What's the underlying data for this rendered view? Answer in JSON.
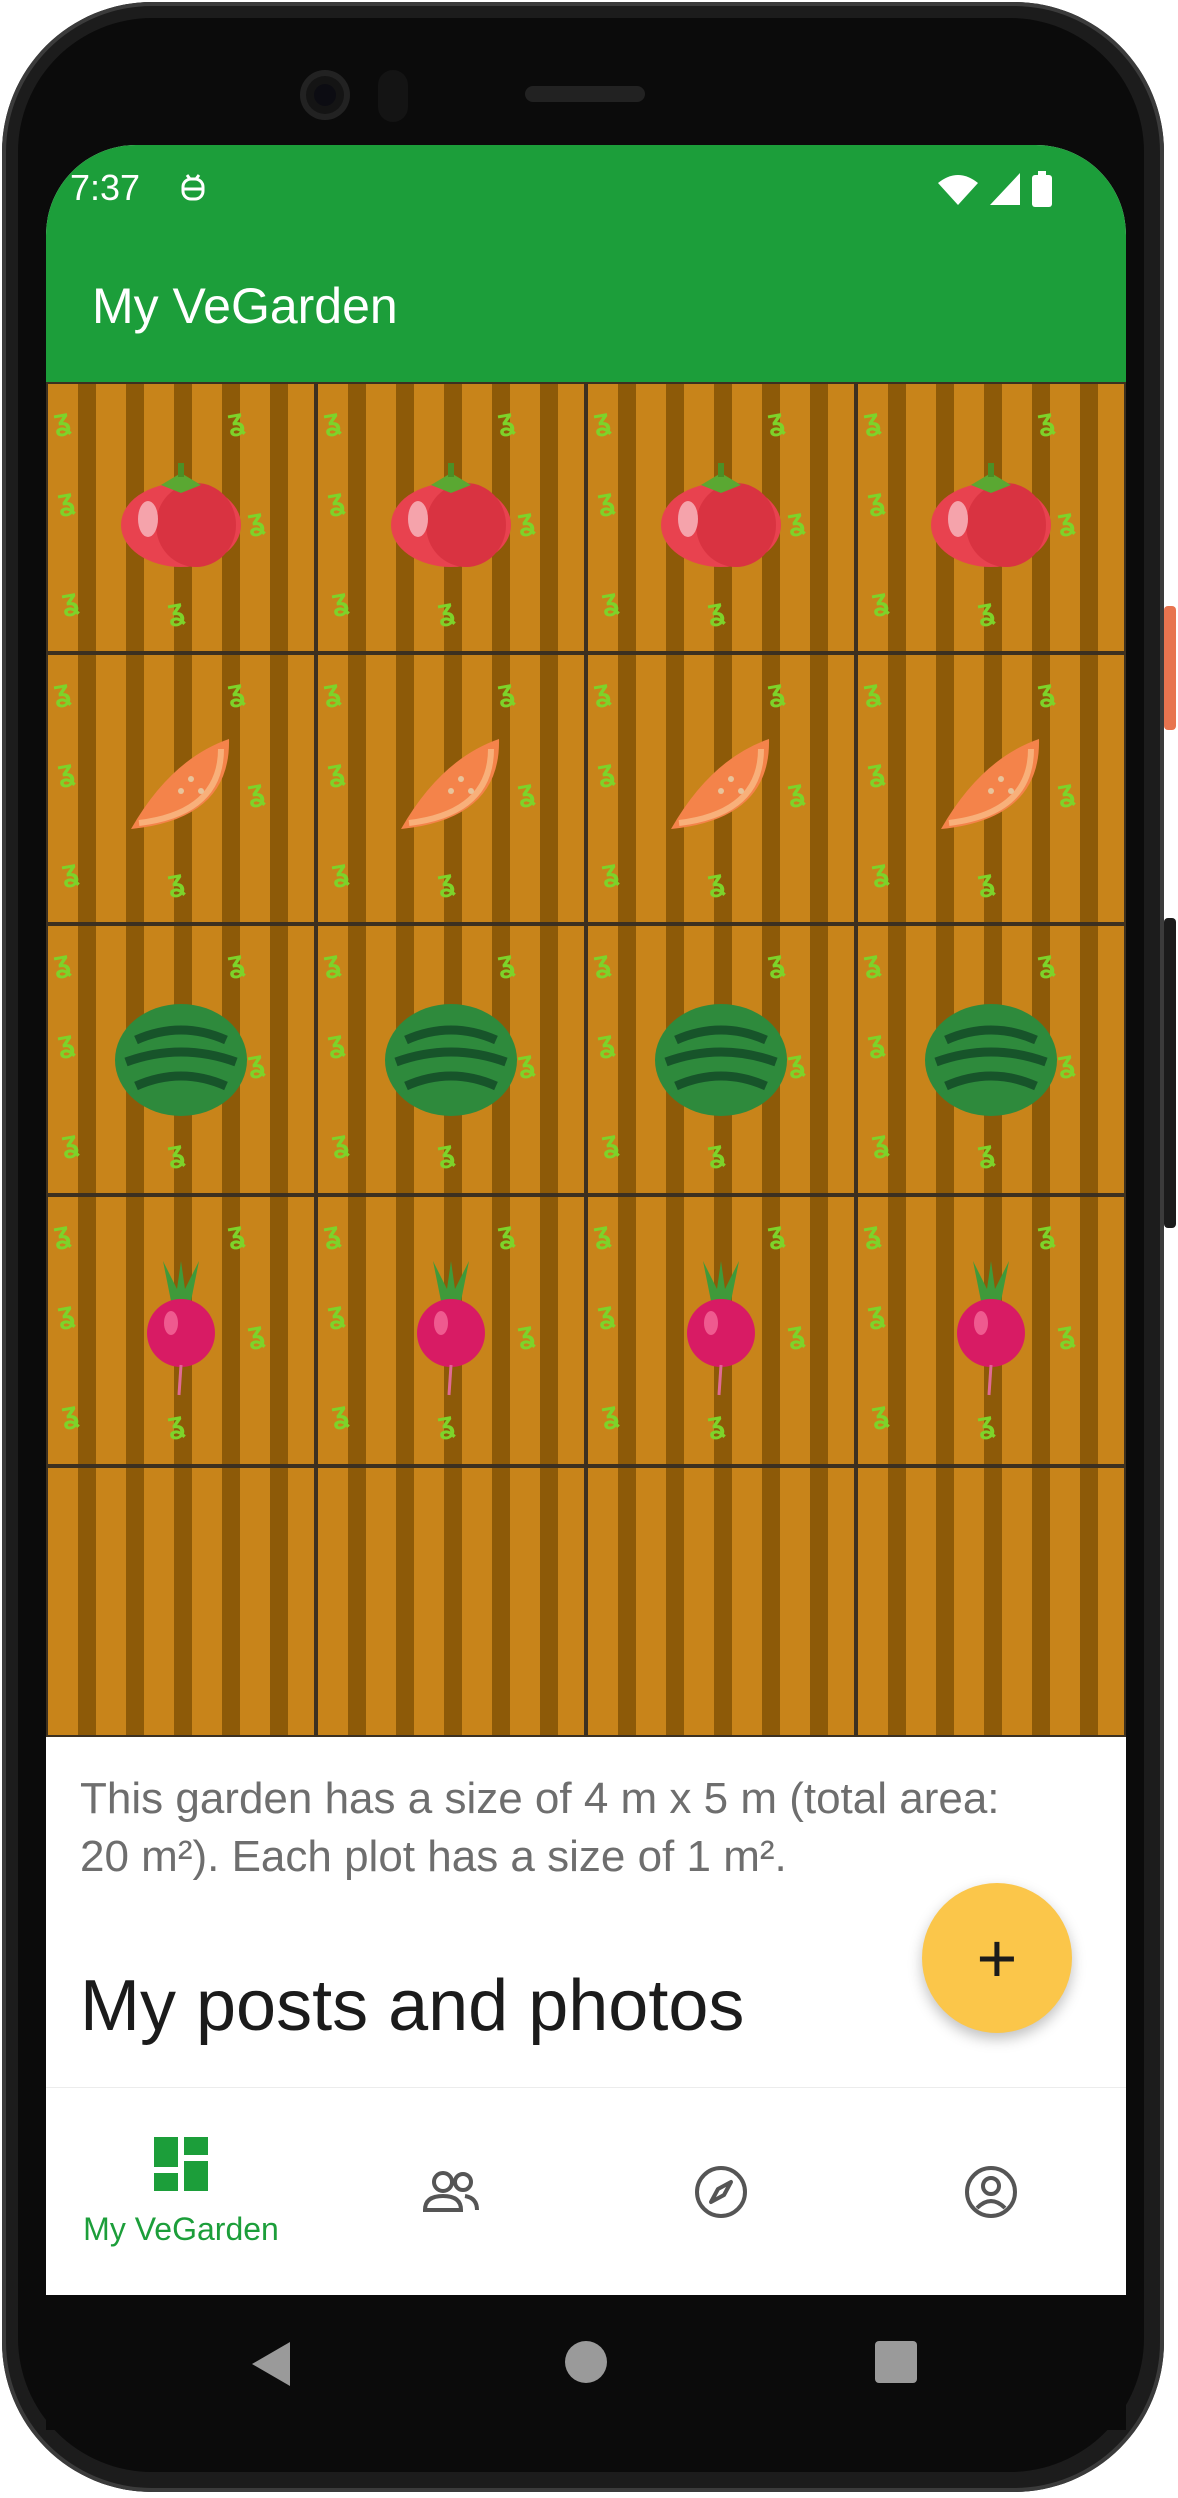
{
  "status_bar": {
    "time": "7:37",
    "icons": [
      "android-debug-icon",
      "wifi-icon",
      "signal-icon",
      "battery-icon"
    ]
  },
  "app_bar": {
    "title": "My VeGarden"
  },
  "garden": {
    "columns": 4,
    "rows": 5,
    "plots": [
      [
        "tomato",
        "tomato",
        "tomato",
        "tomato"
      ],
      [
        "melon",
        "melon",
        "melon",
        "melon"
      ],
      [
        "watermelon",
        "watermelon",
        "watermelon",
        "watermelon"
      ],
      [
        "radish",
        "radish",
        "radish",
        "radish"
      ],
      [
        "empty",
        "empty",
        "empty",
        "empty"
      ]
    ]
  },
  "info": {
    "text": "This garden has a size of 4 m x 5 m (total area: 20 m²). Each plot has a size of 1 m²."
  },
  "posts": {
    "title": "My posts and photos"
  },
  "fab": {
    "label": "+"
  },
  "bottom_nav": {
    "items": [
      {
        "icon": "dashboard-icon",
        "label": "My VeGarden",
        "active": true
      },
      {
        "icon": "people-icon",
        "label": "",
        "active": false
      },
      {
        "icon": "compass-icon",
        "label": "",
        "active": false
      },
      {
        "icon": "account-icon",
        "label": "",
        "active": false
      }
    ]
  },
  "colors": {
    "primary": "#1c9e3a",
    "fab": "#fbc64a",
    "soil_light": "#c8841a",
    "soil_dark": "#8d5a08"
  }
}
